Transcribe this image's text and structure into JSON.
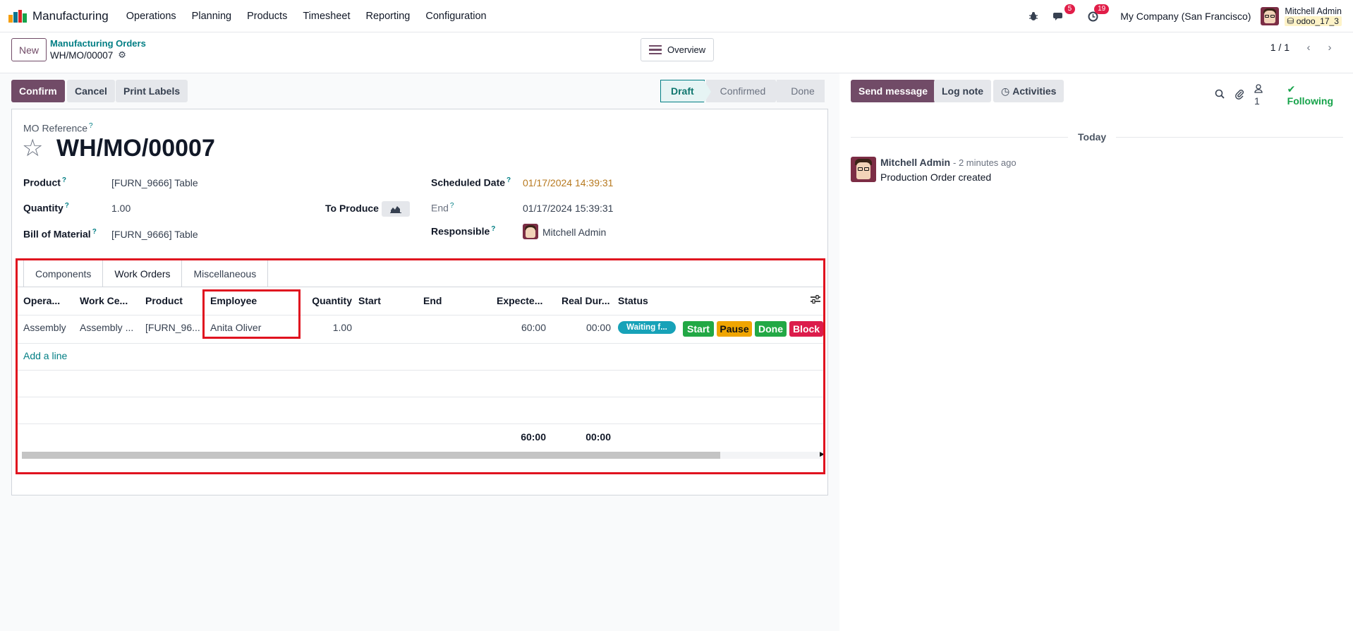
{
  "navbar": {
    "app_name": "Manufacturing",
    "menu": [
      "Operations",
      "Planning",
      "Products",
      "Timesheet",
      "Reporting",
      "Configuration"
    ],
    "icons": [
      "bug-icon",
      "chat-icon",
      "clock-icon"
    ],
    "messages_badge": "5",
    "activities_badge": "19",
    "company": "My Company (San Francisco)",
    "user_name": "Mitchell Admin",
    "db_name": "odoo_17_3"
  },
  "control_panel": {
    "new_label": "New",
    "breadcrumb": "Manufacturing Orders",
    "record_name": "WH/MO/00007",
    "overview_label": "Overview",
    "pager": "1 / 1"
  },
  "header_buttons": {
    "confirm": "Confirm",
    "cancel": "Cancel",
    "print_labels": "Print Labels"
  },
  "statusbar": {
    "stages": [
      "Draft",
      "Confirmed",
      "Done"
    ],
    "active": "Draft"
  },
  "form": {
    "mo_ref_label": "MO Reference",
    "mo_ref_help": "?",
    "title": "WH/MO/00007",
    "product_label": "Product",
    "product_value": "[FURN_9666] Table",
    "quantity_label": "Quantity",
    "quantity_value": "1.00",
    "to_produce_label": "To Produce",
    "bom_label": "Bill of Material",
    "bom_value": "[FURN_9666] Table",
    "scheduled_label": "Scheduled Date",
    "scheduled_value": "01/17/2024 14:39:31",
    "end_label": "End",
    "end_value": "01/17/2024 15:39:31",
    "responsible_label": "Responsible",
    "responsible_value": "Mitchell Admin",
    "help": "?"
  },
  "notebook": {
    "tabs": [
      "Components",
      "Work Orders",
      "Miscellaneous"
    ],
    "active_tab": "Work Orders",
    "columns": [
      "Opera...",
      "Work Ce...",
      "Product",
      "Employee",
      "Quantity",
      "Start",
      "End",
      "Expecte...",
      "Real Dur...",
      "Status"
    ],
    "rows": [
      {
        "operation": "Assembly",
        "work_center": "Assembly ...",
        "product": "[FURN_96...",
        "employee": "Anita Oliver",
        "quantity": "1.00",
        "start": "",
        "end": "",
        "expected": "60:00",
        "real_duration": "00:00",
        "status": "Waiting f...",
        "actions": [
          "Start",
          "Pause",
          "Done",
          "Block"
        ]
      }
    ],
    "add_line": "Add a line",
    "total_expected": "60:00",
    "total_real": "00:00"
  },
  "chatter": {
    "send_message": "Send message",
    "log_note": "Log note",
    "activities": "Activities",
    "followers_count": "1",
    "following": "Following",
    "date_separator": "Today",
    "message": {
      "author": "Mitchell Admin",
      "time": "- 2 minutes ago",
      "body": "Production Order created"
    }
  },
  "colors": {
    "primary": "#714b67",
    "link": "#017e84",
    "highlight_frame": "#e0131f",
    "status_waiting": "#17a2b8",
    "start": "#22a845",
    "pause": "#f0a500",
    "done": "#22a845",
    "block": "#dc1c4b"
  }
}
